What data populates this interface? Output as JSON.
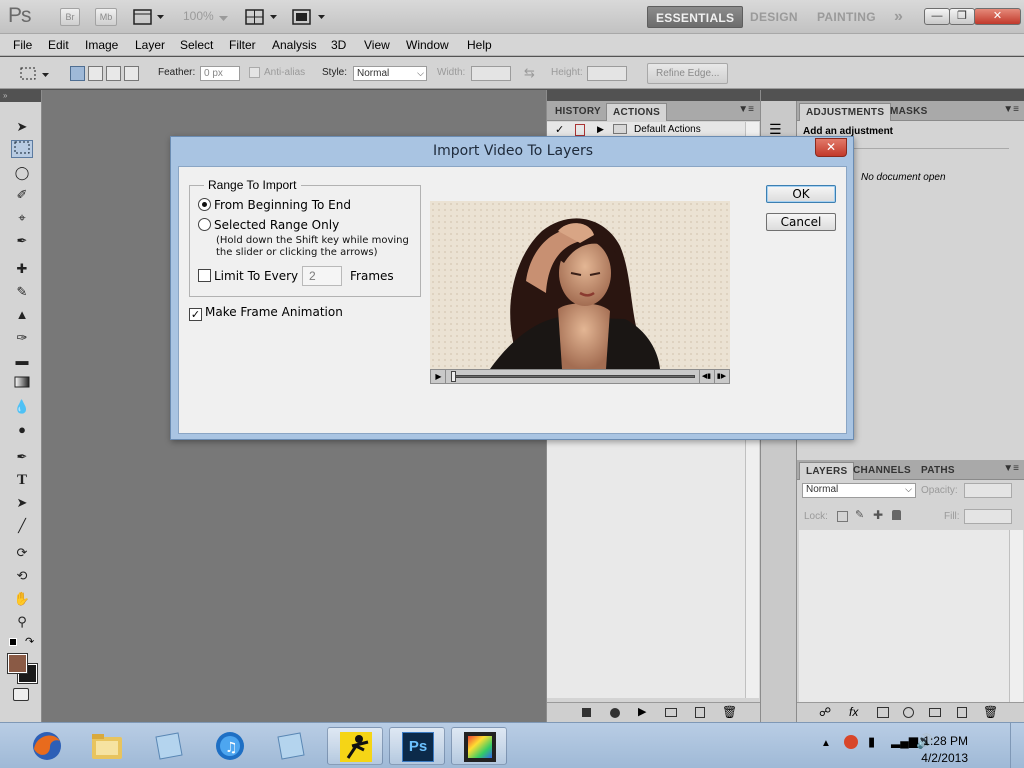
{
  "appbar": {
    "logo": "Ps",
    "br": "Br",
    "mb": "Mb",
    "zoom": "100%",
    "workspaces": [
      "ESSENTIALS",
      "DESIGN",
      "PAINTING"
    ],
    "overflow": "»"
  },
  "menu": [
    "File",
    "Edit",
    "Image",
    "Layer",
    "Select",
    "Filter",
    "Analysis",
    "3D",
    "View",
    "Window",
    "Help"
  ],
  "options": {
    "feather_label": "Feather:",
    "feather_value": "0 px",
    "antialias_label": "Anti-alias",
    "style_label": "Style:",
    "style_value": "Normal",
    "width_label": "Width:",
    "height_label": "Height:",
    "refine_edge": "Refine Edge..."
  },
  "panels": {
    "history_tab": "HISTORY",
    "actions_tab": "ACTIONS",
    "default_actions": "Default Actions",
    "adjustments_tab": "ADJUSTMENTS",
    "masks_tab": "MASKS",
    "add_adjustment": "Add an adjustment",
    "no_document": "No document open",
    "layers_tab": "LAYERS",
    "channels_tab": "CHANNELS",
    "paths_tab": "PATHS",
    "blend_mode": "Normal",
    "opacity_label": "Opacity:",
    "lock_label": "Lock:",
    "fill_label": "Fill:"
  },
  "dialog": {
    "title": "Import Video To Layers",
    "range_group": "Range To Import",
    "option_all": "From Beginning To End",
    "option_selected": "Selected Range Only",
    "hint": "(Hold down the Shift key while moving the slider or clicking the arrows)",
    "limit_label": "Limit To Every",
    "limit_value": "2",
    "frames_label": "Frames",
    "make_animation": "Make Frame Animation",
    "ok": "OK",
    "cancel": "Cancel"
  },
  "taskbar": {
    "time": "1:28 PM",
    "date": "4/2/2013",
    "ps_label": "Ps"
  }
}
